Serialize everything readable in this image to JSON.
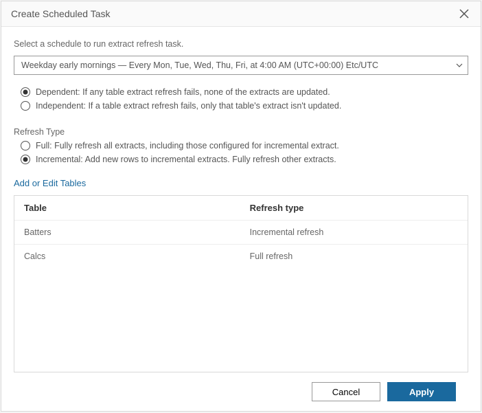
{
  "header": {
    "title": "Create Scheduled Task"
  },
  "instruction": "Select a schedule to run extract refresh task.",
  "schedule": {
    "selected": "Weekday early mornings — Every Mon, Tue, Wed, Thu, Fri, at 4:00 AM (UTC+00:00) Etc/UTC"
  },
  "dependency": {
    "options": [
      {
        "label": "Dependent: If any table extract refresh fails, none of the extracts are updated.",
        "checked": true
      },
      {
        "label": "Independent: If a table extract refresh fails, only that table's extract isn't updated.",
        "checked": false
      }
    ]
  },
  "refresh_type": {
    "section_label": "Refresh Type",
    "options": [
      {
        "label": "Full: Fully refresh all extracts, including those configured for incremental extract.",
        "checked": false
      },
      {
        "label": "Incremental: Add new rows to incremental extracts. Fully refresh other extracts.",
        "checked": true
      }
    ]
  },
  "tables_link": "Add or Edit Tables",
  "table": {
    "headers": {
      "table": "Table",
      "refresh_type": "Refresh type"
    },
    "rows": [
      {
        "table": "Batters",
        "refresh_type": "Incremental refresh"
      },
      {
        "table": "Calcs",
        "refresh_type": "Full refresh"
      }
    ]
  },
  "footer": {
    "cancel": "Cancel",
    "apply": "Apply"
  }
}
